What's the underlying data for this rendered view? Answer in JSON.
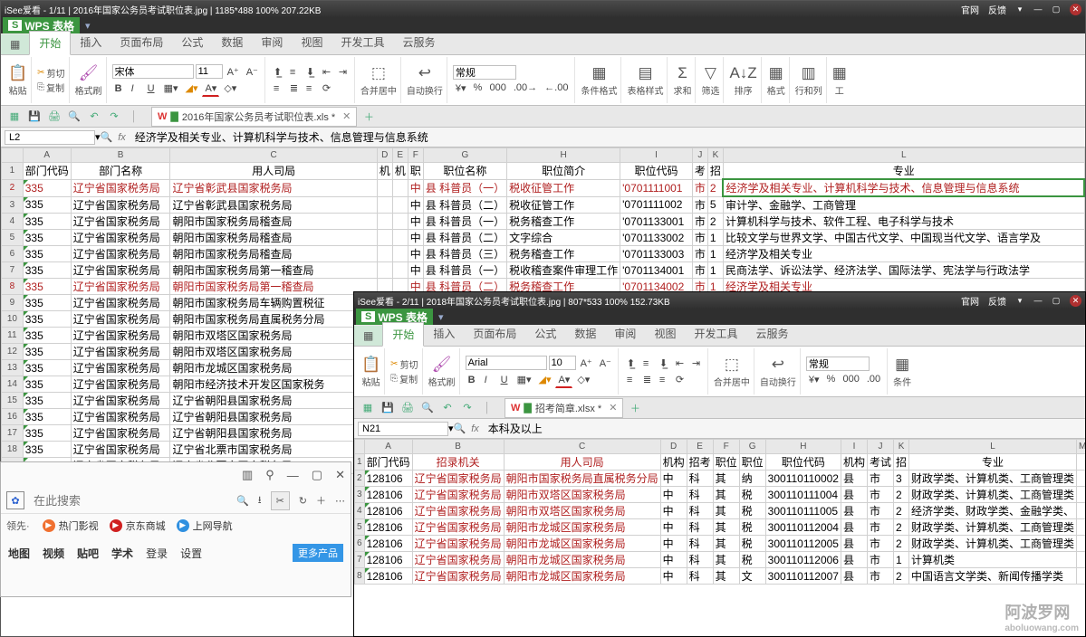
{
  "win1": {
    "title": "iSee爱看 - 1/11 | 2016年国家公务员考试职位表.jpg | 1185*488  100%  207.22KB",
    "right_links": [
      "官网",
      "反馈"
    ],
    "app_name": "WPS 表格",
    "menu_tabs": [
      "开始",
      "插入",
      "页面布局",
      "公式",
      "数据",
      "审阅",
      "视图",
      "开发工具",
      "云服务"
    ],
    "ribbon": {
      "paste": "粘贴",
      "cut": "剪切",
      "copy": "复制",
      "fmtpaint": "格式刷",
      "font": "宋体",
      "fontsize": "11",
      "merge": "合并居中",
      "wrap": "自动换行",
      "genfmt": "常规",
      "cfmt": "条件格式",
      "tstyle": "表格样式",
      "sum": "求和",
      "filter": "筛选",
      "sort": "排序",
      "format": "格式",
      "rowcol": "行和列",
      "ws": "工"
    },
    "workbook_tab": "2016年国家公务员考试职位表.xls *",
    "namebox": "L2",
    "formula": "经济学及相关专业、计算机科学与技术、信息管理与信息系统",
    "cols": [
      "A",
      "B",
      "C",
      "D",
      "E",
      "F",
      "G",
      "H",
      "I",
      "J",
      "K",
      "L"
    ],
    "widths": [
      38,
      110,
      230,
      12,
      12,
      12,
      80,
      120,
      80,
      14,
      14,
      400
    ],
    "header_row": [
      "部门代码",
      "部门名称",
      "用人司局",
      "机",
      "机",
      "职",
      "职位名称",
      "职位简介",
      "职位代码",
      "考",
      "招",
      "专业"
    ],
    "rows": [
      {
        "r": 2,
        "red": true,
        "c": [
          "335",
          "辽宁省国家税务局",
          "辽宁省彰武县国家税务局",
          "",
          "",
          "中",
          "县 科普员（一）",
          "税收征管工作",
          "'0701111001",
          "市",
          "2",
          "经济学及相关专业、计算机科学与技术、信息管理与信息系统"
        ]
      },
      {
        "r": 3,
        "c": [
          "335",
          "辽宁省国家税务局",
          "辽宁省彰武县国家税务局",
          "",
          "",
          "中",
          "县 科普员（二）",
          "税收征管工作",
          "'0701111002",
          "市",
          "5",
          "审计学、金融学、工商管理"
        ]
      },
      {
        "r": 4,
        "c": [
          "335",
          "辽宁省国家税务局",
          "朝阳市国家税务局稽查局",
          "",
          "",
          "中",
          "县 科普员（一）",
          "税务稽查工作",
          "'0701133001",
          "市",
          "2",
          "计算机科学与技术、软件工程、电子科学与技术"
        ]
      },
      {
        "r": 5,
        "c": [
          "335",
          "辽宁省国家税务局",
          "朝阳市国家税务局稽查局",
          "",
          "",
          "中",
          "县 科普员（二）",
          "文字综合",
          "'0701133002",
          "市",
          "1",
          "比较文学与世界文学、中国古代文学、中国现当代文学、语言学及"
        ]
      },
      {
        "r": 6,
        "c": [
          "335",
          "辽宁省国家税务局",
          "朝阳市国家税务局稽查局",
          "",
          "",
          "中",
          "县 科普员（三）",
          "税务稽查工作",
          "'0701133003",
          "市",
          "1",
          "经济学及相关专业"
        ]
      },
      {
        "r": 7,
        "c": [
          "335",
          "辽宁省国家税务局",
          "朝阳市国家税务局第一稽查局",
          "",
          "",
          "中",
          "县 科普员（一）",
          "税收稽查案件审理工作",
          "'0701134001",
          "市",
          "1",
          "民商法学、诉讼法学、经济法学、国际法学、宪法学与行政法学"
        ]
      },
      {
        "r": 8,
        "red": true,
        "c": [
          "335",
          "辽宁省国家税务局",
          "朝阳市国家税务局第一稽查局",
          "",
          "",
          "中",
          "县 科普员（二）",
          "税务稽查工作",
          "'0701134002",
          "市",
          "1",
          "经济学及相关专业"
        ]
      },
      {
        "r": 9,
        "c": [
          "335",
          "辽宁省国家税务局",
          "朝阳市国家税务局车辆购置税征",
          "",
          "",
          "",
          "",
          "",
          "",
          "",
          "",
          ""
        ]
      },
      {
        "r": 10,
        "c": [
          "335",
          "辽宁省国家税务局",
          "朝阳市国家税务局直属税务分局",
          "",
          "",
          "",
          "",
          "",
          "",
          "",
          "",
          ""
        ]
      },
      {
        "r": 11,
        "c": [
          "335",
          "辽宁省国家税务局",
          "朝阳市双塔区国家税务局",
          "",
          "",
          "",
          "",
          "",
          "",
          "",
          "",
          ""
        ]
      },
      {
        "r": 12,
        "c": [
          "335",
          "辽宁省国家税务局",
          "朝阳市双塔区国家税务局",
          "",
          "",
          "",
          "",
          "",
          "",
          "",
          "",
          ""
        ]
      },
      {
        "r": 13,
        "c": [
          "335",
          "辽宁省国家税务局",
          "朝阳市龙城区国家税务局",
          "",
          "",
          "",
          "",
          "",
          "",
          "",
          "",
          ""
        ]
      },
      {
        "r": 14,
        "c": [
          "335",
          "辽宁省国家税务局",
          "朝阳市经济技术开发区国家税务",
          "",
          "",
          "",
          "",
          "",
          "",
          "",
          "",
          ""
        ]
      },
      {
        "r": 15,
        "c": [
          "335",
          "辽宁省国家税务局",
          "辽宁省朝阳县国家税务局",
          "",
          "",
          "",
          "",
          "",
          "",
          "",
          "",
          ""
        ]
      },
      {
        "r": 16,
        "c": [
          "335",
          "辽宁省国家税务局",
          "辽宁省朝阳县国家税务局",
          "",
          "",
          "",
          "",
          "",
          "",
          "",
          "",
          ""
        ]
      },
      {
        "r": 17,
        "c": [
          "335",
          "辽宁省国家税务局",
          "辽宁省朝阳县国家税务局",
          "",
          "",
          "",
          "",
          "",
          "",
          "",
          "",
          ""
        ]
      },
      {
        "r": 18,
        "c": [
          "335",
          "辽宁省国家税务局",
          "辽宁省北票市国家税务局",
          "",
          "",
          "",
          "",
          "",
          "",
          "",
          "",
          ""
        ]
      },
      {
        "r": 19,
        "c": [
          "335",
          "辽宁省国家税务局",
          "辽宁省北票市国家税务局",
          "",
          "",
          "",
          "",
          "",
          "",
          "",
          "",
          ""
        ]
      }
    ]
  },
  "win2": {
    "title": "iSee爱看 - 2/11 | 2018年国家公务员考试职位表.jpg | 807*533  100%  152.73KB",
    "right_links": [
      "官网",
      "反馈"
    ],
    "app_name": "WPS 表格",
    "menu_tabs": [
      "开始",
      "插入",
      "页面布局",
      "公式",
      "数据",
      "审阅",
      "视图",
      "开发工具",
      "云服务"
    ],
    "ribbon": {
      "paste": "粘贴",
      "cut": "剪切",
      "copy": "复制",
      "fmtpaint": "格式刷",
      "font": "Arial",
      "fontsize": "10",
      "merge": "合并居中",
      "wrap": "自动换行",
      "genfmt": "常规",
      "cfmt": "条件"
    },
    "workbook_tab": "招考简章.xlsx *",
    "namebox": "N21",
    "formula": "本科及以上",
    "cols": [
      "A",
      "B",
      "C",
      "D",
      "E",
      "F",
      "G",
      "H",
      "I",
      "J",
      "K",
      "L",
      "M"
    ],
    "widths": [
      50,
      100,
      170,
      14,
      14,
      14,
      14,
      80,
      14,
      14,
      14,
      200,
      50
    ],
    "header_row": [
      "部门代码",
      "招录机关",
      "用人司局",
      "机构",
      "招考",
      "职位",
      "职位",
      "职位代码",
      "机构",
      "考试",
      "招",
      "专业",
      ""
    ],
    "rows": [
      {
        "r": 2,
        "c": [
          "128106",
          "辽宁省国家税务局",
          "朝阳市国家税务局直属税务分局",
          "中",
          "科",
          "其",
          "纳",
          "300110110002",
          "县",
          "市",
          "3",
          "财政学类、计算机类、工商管理类",
          ""
        ]
      },
      {
        "r": 3,
        "c": [
          "128106",
          "辽宁省国家税务局",
          "朝阳市双塔区国家税务局",
          "中",
          "科",
          "其",
          "税",
          "300110111004",
          "县",
          "市",
          "2",
          "财政学类、计算机类、工商管理类",
          ""
        ]
      },
      {
        "r": 4,
        "c": [
          "128106",
          "辽宁省国家税务局",
          "朝阳市双塔区国家税务局",
          "中",
          "科",
          "其",
          "税",
          "300110111005",
          "县",
          "市",
          "2",
          "经济学类、财政学类、金融学类、",
          ""
        ]
      },
      {
        "r": 5,
        "c": [
          "128106",
          "辽宁省国家税务局",
          "朝阳市龙城区国家税务局",
          "中",
          "科",
          "其",
          "税",
          "300110112004",
          "县",
          "市",
          "2",
          "财政学类、计算机类、工商管理类",
          ""
        ]
      },
      {
        "r": 6,
        "c": [
          "128106",
          "辽宁省国家税务局",
          "朝阳市龙城区国家税务局",
          "中",
          "科",
          "其",
          "税",
          "300110112005",
          "县",
          "市",
          "2",
          "财政学类、计算机类、工商管理类",
          ""
        ]
      },
      {
        "r": 7,
        "c": [
          "128106",
          "辽宁省国家税务局",
          "朝阳市龙城区国家税务局",
          "中",
          "科",
          "其",
          "税",
          "300110112006",
          "县",
          "市",
          "1",
          "计算机类",
          ""
        ]
      },
      {
        "r": 8,
        "c": [
          "128106",
          "辽宁省国家税务局",
          "朝阳市龙城区国家税务局",
          "中",
          "科",
          "其",
          "文",
          "300110112007",
          "县",
          "市",
          "2",
          "中国语言文学类、新闻传播学类",
          ""
        ]
      }
    ]
  },
  "win3": {
    "search_placeholder": "在此搜索",
    "lead": "领先·",
    "quick": [
      {
        "txt": "热门影视",
        "col": "#f07030"
      },
      {
        "txt": "京东商城",
        "col": "#d02020"
      },
      {
        "txt": "上网导航",
        "col": "#3090e0"
      }
    ],
    "nav": [
      "地图",
      "视频",
      "贴吧",
      "学术",
      "登录",
      "设置"
    ],
    "more": "更多产品"
  },
  "watermark": {
    "main": "阿波罗网",
    "sub": "aboluowang.com"
  }
}
